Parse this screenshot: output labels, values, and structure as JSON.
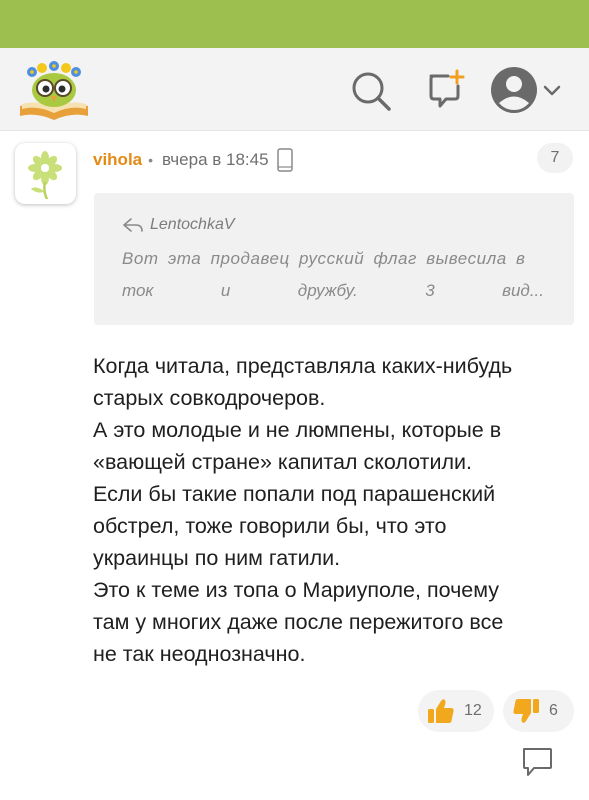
{
  "header": {
    "logo": "book-owl-logo",
    "icons": [
      "search-icon",
      "compose-icon",
      "avatar-icon",
      "chevron-down-icon"
    ]
  },
  "colors": {
    "topbar": "#9dbf4f",
    "username": "#e48a16",
    "thumb": "#f2a81d"
  },
  "comment": {
    "username": "vihola",
    "separator": "•",
    "time": "вчера в 18:45",
    "device_icon": "phone-icon",
    "count": "7",
    "quote": {
      "author": "LentochkaV",
      "line1": "Вот эта продавец русский флаг вывесила в",
      "line2_words": [
        "ток",
        "и",
        "дружбу.",
        "3",
        "вид..."
      ]
    },
    "text_lines": [
      "Когда читала, представляла каких-нибудь",
      "старых совкодрочеров.",
      "А это молодые и не люмпены, которые в",
      "«вающей стране» капитал сколотили.",
      "Если бы такие попали под парашенский",
      "обстрел, тоже говорили бы, что это",
      "украинцы по ним гатили.",
      "Это к теме из топа о Мариуполе, почему",
      "там у многих даже после пережитого все",
      "не так неоднозначно."
    ],
    "likes": "12",
    "dislikes": "6"
  }
}
